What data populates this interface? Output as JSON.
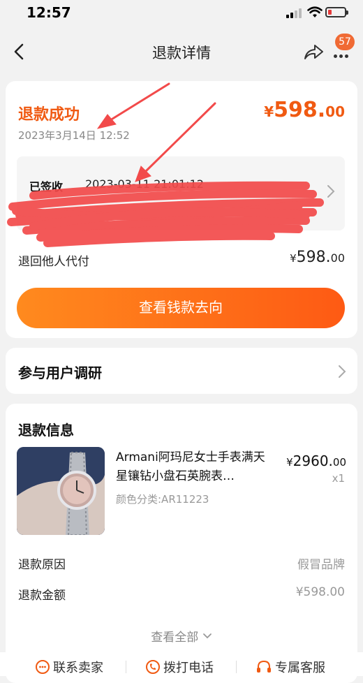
{
  "status_bar": {
    "time": "12:57"
  },
  "header": {
    "title": "退款详情",
    "badge": "57"
  },
  "summary": {
    "status": "退款成功",
    "date": "2023年3月14日 12:52",
    "amount_symbol": "¥",
    "amount_int": "598.",
    "amount_dec": "00"
  },
  "logistics": {
    "status": "已签收",
    "time": "2023-03-11 21:01:12"
  },
  "refund_row": {
    "label": "退回他人代付",
    "symbol": "¥",
    "int": "598.",
    "dec": "00"
  },
  "cta": {
    "label": "查看钱款去向"
  },
  "survey": {
    "label": "参与用户调研"
  },
  "refund_info": {
    "title": "退款信息",
    "product": {
      "name": "Armani阿玛尼女士手表满天星镶钻小盘石英腕表…",
      "price_symbol": "¥",
      "price_int": "2960.",
      "price_dec": "00",
      "qty": "x1",
      "sku": "颜色分类:AR11223"
    },
    "rows": [
      {
        "label": "退款原因",
        "value": "假冒品牌"
      },
      {
        "label": "退款金额",
        "value": "¥598.00"
      }
    ],
    "view_all": "查看全部"
  },
  "bottom_bar": {
    "contact_seller": "联系卖家",
    "call": "拨打电话",
    "exclusive_service": "专属客服"
  },
  "colors": {
    "accent": "#f05a12",
    "button_start": "#ff8a1e",
    "button_end": "#fe5a14",
    "annotation_red": "#f24a4a"
  }
}
